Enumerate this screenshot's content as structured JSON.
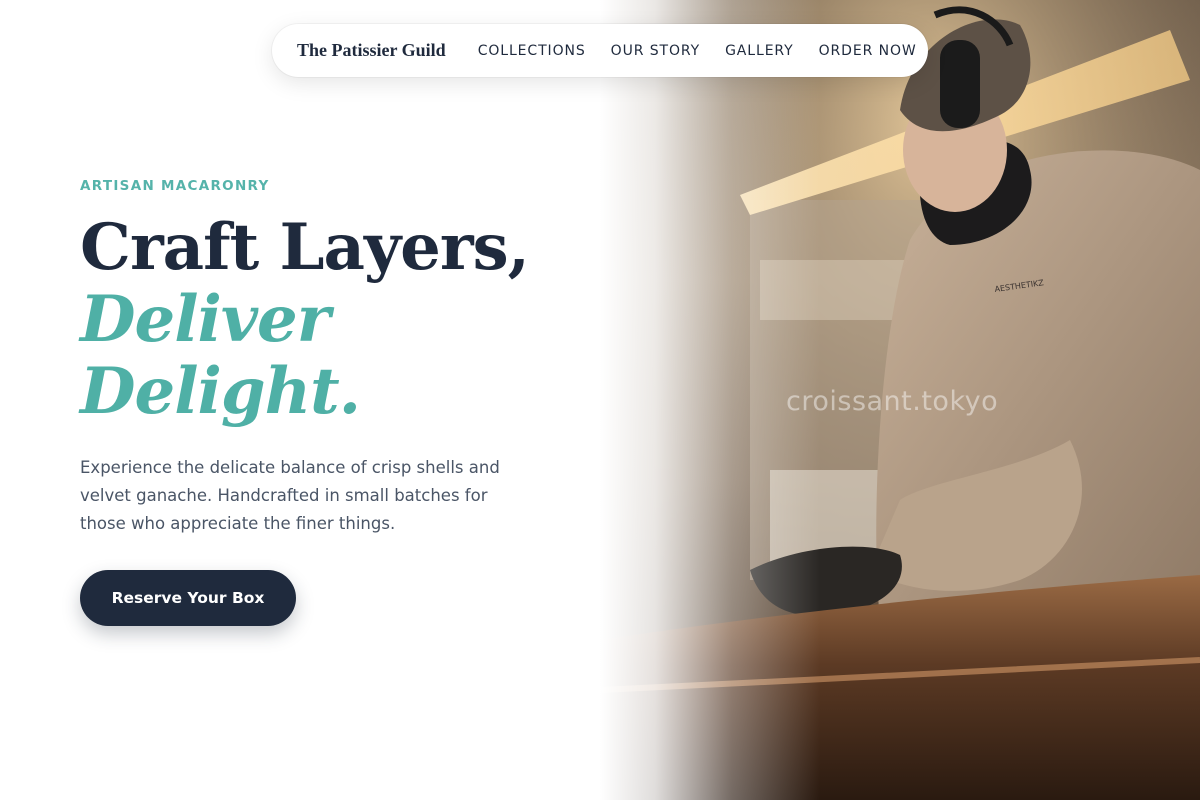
{
  "nav": {
    "brand": "The Patissier Guild",
    "links": [
      "COLLECTIONS",
      "OUR STORY",
      "GALLERY",
      "ORDER NOW"
    ]
  },
  "hero": {
    "eyebrow": "ARTISAN MACARONRY",
    "headline_line1": "Craft Layers,",
    "headline_line2": "Deliver",
    "headline_line3": "Delight.",
    "description": "Experience the delicate balance of crisp shells and velvet ganache. Handcrafted in small batches for those who appreciate the finer things.",
    "cta_label": "Reserve Your Box"
  },
  "photo": {
    "watermark": "croissant.tokyo",
    "sweatshirt_text": "AESTHETIKZ"
  },
  "colors": {
    "navy": "#1f2a3d",
    "teal": "#4fb0a6",
    "body_text": "#4a5566"
  }
}
